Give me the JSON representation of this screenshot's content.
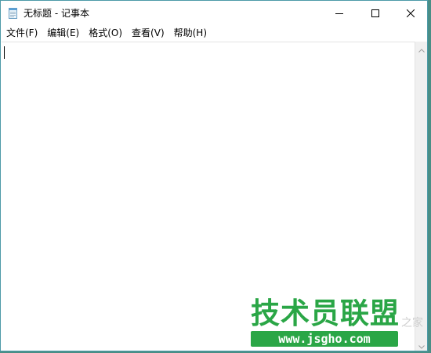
{
  "window": {
    "title": "无标题 - 记事本"
  },
  "menu": [
    {
      "label": "文件(F)"
    },
    {
      "label": "编辑(E)"
    },
    {
      "label": "格式(O)"
    },
    {
      "label": "查看(V)"
    },
    {
      "label": "帮助(H)"
    }
  ],
  "editor": {
    "content": ""
  },
  "icons": {
    "app": "notepad-icon",
    "minimize": "minimize-icon",
    "maximize": "maximize-icon",
    "close": "close-icon",
    "scroll_up": "chevron-up-icon",
    "scroll_down": "chevron-down-icon"
  },
  "watermark": {
    "title": "技术员联盟",
    "url": "www.jsgho.com",
    "side_text": "之家"
  },
  "colors": {
    "watermark_green": "#2aa646",
    "window_border": "#4d9aa8",
    "desktop": "#4a8e86"
  }
}
